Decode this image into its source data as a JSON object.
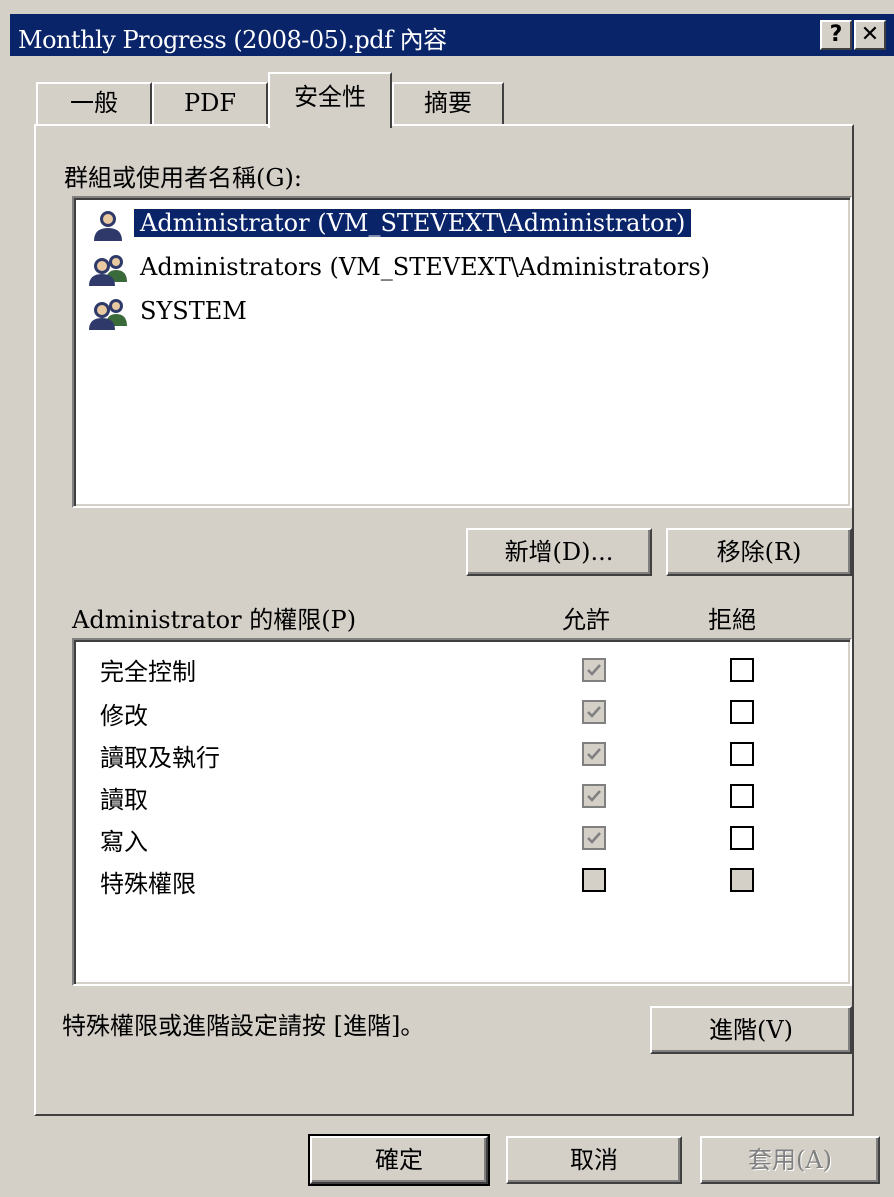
{
  "window": {
    "title": "Monthly Progress (2008-05).pdf 內容",
    "help_button": "?",
    "close_button": "✕"
  },
  "tabs": [
    {
      "label": "一般",
      "selected": false
    },
    {
      "label": "PDF",
      "selected": false
    },
    {
      "label": "安全性",
      "selected": true
    },
    {
      "label": "摘要",
      "selected": false
    }
  ],
  "users_section": {
    "label": "群組或使用者名稱(G):",
    "items": [
      {
        "name": "Administrator (VM_STEVEXT\\Administrator)",
        "icon": "user-icon",
        "selected": true
      },
      {
        "name": "Administrators (VM_STEVEXT\\Administrators)",
        "icon": "group-icon",
        "selected": false
      },
      {
        "name": "SYSTEM",
        "icon": "group-icon",
        "selected": false
      }
    ],
    "add_button": "新增(D)...",
    "remove_button": "移除(R)"
  },
  "permissions_section": {
    "label": "Administrator 的權限(P)",
    "allow_header": "允許",
    "deny_header": "拒絕",
    "items": [
      {
        "name": "完全控制",
        "allow": "checked-disabled",
        "deny": "unchecked"
      },
      {
        "name": "修改",
        "allow": "checked-disabled",
        "deny": "unchecked"
      },
      {
        "name": "讀取及執行",
        "allow": "checked-disabled",
        "deny": "unchecked"
      },
      {
        "name": "讀取",
        "allow": "checked-disabled",
        "deny": "unchecked"
      },
      {
        "name": "寫入",
        "allow": "checked-disabled",
        "deny": "unchecked"
      },
      {
        "name": "特殊權限",
        "allow": "unchecked-disabled",
        "deny": "unchecked-disabled"
      }
    ]
  },
  "advanced": {
    "hint": "特殊權限或進階設定請按 [進階]。",
    "button": "進階(V)"
  },
  "footer": {
    "ok": "確定",
    "cancel": "取消",
    "apply": "套用(A)"
  },
  "colors": {
    "titlebar": "#0a246a",
    "face": "#d4d0c8",
    "selection": "#0a246a"
  }
}
